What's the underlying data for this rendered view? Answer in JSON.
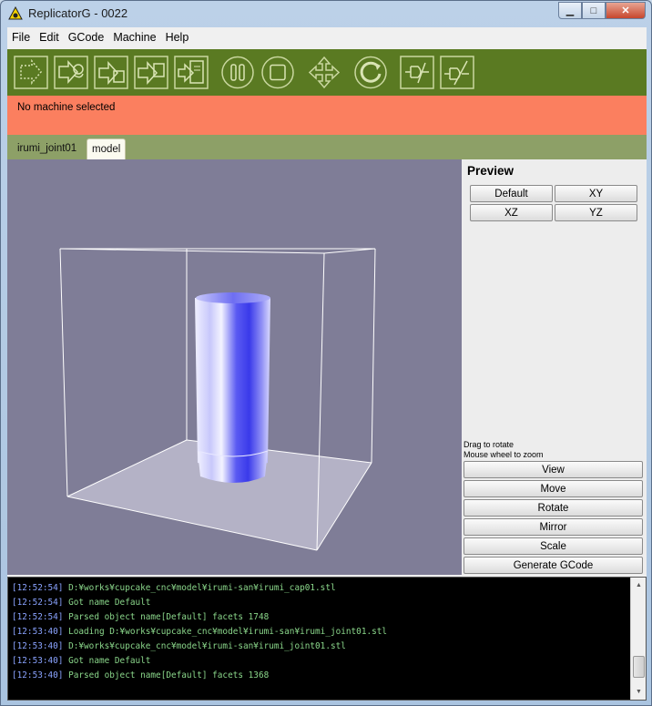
{
  "window": {
    "title": "ReplicatorG - 0022"
  },
  "menu": [
    "File",
    "Edit",
    "GCode",
    "Machine",
    "Help"
  ],
  "toolbar": {
    "icons": [
      "build-icon",
      "build-from-file-icon",
      "upload-icon",
      "build-to-file-icon",
      "file-from-sd-icon",
      "pause-icon",
      "stop-icon",
      "control-panel-icon",
      "reset-icon",
      "connect-icon",
      "disconnect-icon"
    ]
  },
  "status": {
    "text": "No machine selected"
  },
  "tabs": [
    {
      "label": "irumi_joint01",
      "active": false
    },
    {
      "label": "model",
      "active": true
    }
  ],
  "preview": {
    "title": "Preview",
    "view_buttons": [
      "Default",
      "XY",
      "XZ",
      "YZ"
    ],
    "hint_rotate": "Drag to rotate",
    "hint_zoom": "Mouse wheel to zoom",
    "actions": [
      "View",
      "Move",
      "Rotate",
      "Mirror",
      "Scale",
      "Generate GCode"
    ]
  },
  "console": {
    "lines": [
      {
        "time": "[12:52:54]",
        "text": "D:¥works¥cupcake_cnc¥model¥irumi-san¥irumi_cap01.stl"
      },
      {
        "time": "[12:52:54]",
        "text": "Got name Default"
      },
      {
        "time": "[12:52:54]",
        "text": "Parsed object name[Default] facets 1748"
      },
      {
        "time": "[12:53:40]",
        "text": "Loading D:¥works¥cupcake_cnc¥model¥irumi-san¥irumi_joint01.stl"
      },
      {
        "time": "[12:53:40]",
        "text": "D:¥works¥cupcake_cnc¥model¥irumi-san¥irumi_joint01.stl"
      },
      {
        "time": "[12:53:40]",
        "text": "Got name Default"
      },
      {
        "time": "[12:53:40]",
        "text": "Parsed object name[Default] facets 1368"
      }
    ]
  },
  "colors": {
    "toolbar_bg": "#5a7a22",
    "status_bg": "#fb7f5f",
    "tabbar_bg": "#8da067",
    "viewport_bg": "#7f7d97",
    "timestamp": "#8aa3ff",
    "log_text": "#8ad68a"
  }
}
